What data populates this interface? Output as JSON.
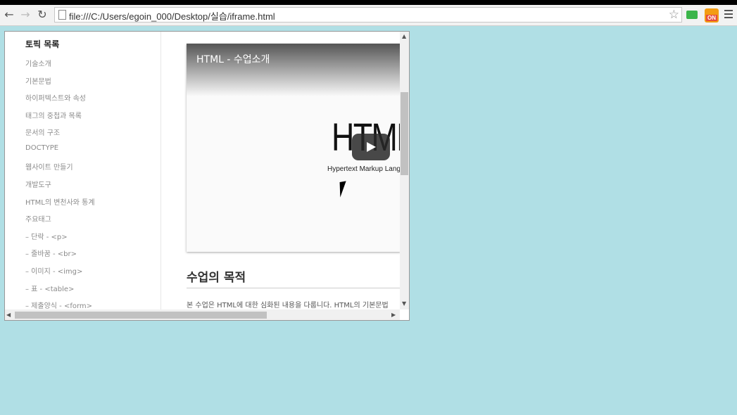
{
  "browser": {
    "url": "file:///C:/Users/egoin_000/Desktop/실습/iframe.html",
    "back_icon": "arrow-left-icon",
    "forward_icon": "arrow-right-icon",
    "reload_icon": "reload-icon",
    "ext_badge": "ON"
  },
  "sidebar": {
    "title": "토픽 목록",
    "items": [
      "기술소개",
      "기본문법",
      "하이퍼텍스트와 속성",
      "태그의 중첩과 목록",
      "문서의 구조",
      "DOCTYPE",
      "웹사이트 만들기",
      "개발도구",
      "HTML의 변천사와 통계",
      "주요태그",
      "– 단락 - <p>",
      "– 줄바꿈 - <br>",
      "– 이미지 - <img>",
      "– 표 - <table>",
      "– 제출양식 - <form>"
    ]
  },
  "video": {
    "title": "HTML - 수업소개",
    "big_text": "HTML",
    "subtitle": "Hypertext Markup Language"
  },
  "content": {
    "section_title": "수업의 목적",
    "body": "본 수업은 HTML에 대한 심화된 내용을 다룹니다. HTML의 기본문법"
  }
}
